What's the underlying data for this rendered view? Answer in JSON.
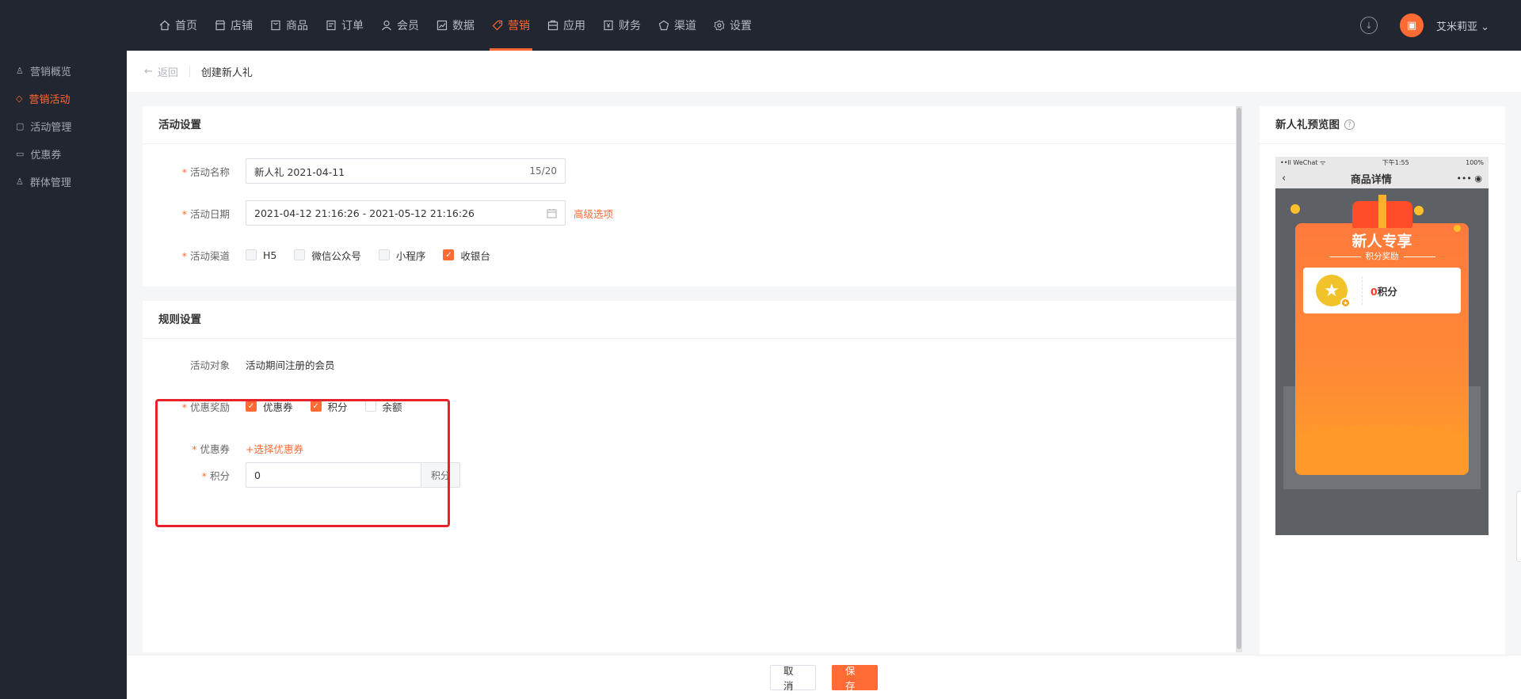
{
  "topnav": {
    "items": [
      {
        "label": "首页",
        "icon": "home-icon"
      },
      {
        "label": "店铺",
        "icon": "store-icon"
      },
      {
        "label": "商品",
        "icon": "goods-icon"
      },
      {
        "label": "订单",
        "icon": "order-icon"
      },
      {
        "label": "会员",
        "icon": "member-icon"
      },
      {
        "label": "数据",
        "icon": "chart-icon"
      },
      {
        "label": "营销",
        "icon": "tag-icon"
      },
      {
        "label": "应用",
        "icon": "app-icon"
      },
      {
        "label": "财务",
        "icon": "finance-icon"
      },
      {
        "label": "渠道",
        "icon": "channel-icon"
      },
      {
        "label": "设置",
        "icon": "gear-icon"
      }
    ],
    "active": "营销",
    "user_name": "艾米莉亚 ⌄",
    "accent": "#ff6a35"
  },
  "sidebar": {
    "items": [
      {
        "label": "营销概览"
      },
      {
        "label": "营销活动"
      },
      {
        "label": "活动管理"
      },
      {
        "label": "优惠券"
      },
      {
        "label": "群体管理"
      }
    ]
  },
  "header": {
    "back": "返回",
    "title": "创建新人礼"
  },
  "activity": {
    "section_title": "活动设置",
    "name_label": "活动名称",
    "name_value": "新人礼  2021-04-11",
    "name_counter": "15/20",
    "date_label": "活动日期",
    "date_value": "2021-04-12 21:16:26 - 2021-05-12 21:16:26",
    "advanced": "高级选项",
    "channel_label": "活动渠道",
    "channels": [
      "H5",
      "微信公众号",
      "小程序",
      "收银台"
    ]
  },
  "rules": {
    "section_title": "规则设置",
    "target_label": "活动对象",
    "target_value": "活动期间注册的会员",
    "reward_label": "优惠奖励",
    "rewards": [
      "优惠券",
      "积分",
      "余额"
    ],
    "coupon_label": "优惠券",
    "coupon_link": "+选择优惠券",
    "points_label": "积分",
    "points_value": "0",
    "points_unit": "积分"
  },
  "preview": {
    "title": "新人礼预览图",
    "status_left": "••ll WeChat ᯤ",
    "status_time": "下午1:55",
    "status_right": "100%",
    "phone_title": "商品详情",
    "popup_title": "新人专享",
    "popup_sub": "积分奖励",
    "reward_num": "0",
    "reward_unit": "积分"
  },
  "footer": {
    "cancel": "取消",
    "save": "保存"
  }
}
